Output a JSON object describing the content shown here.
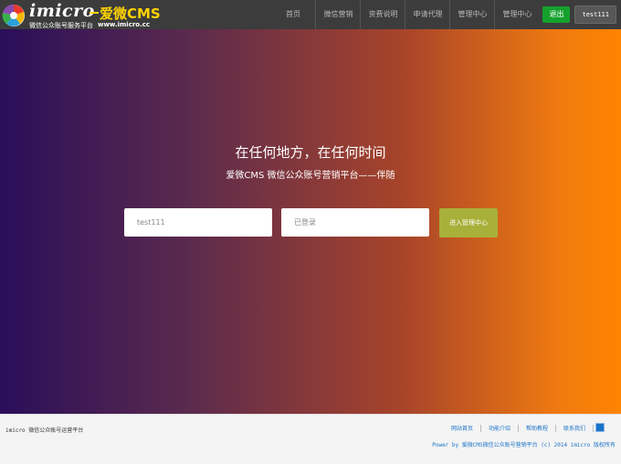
{
  "header": {
    "logo_word": "imicro",
    "logo_brand": "爱微CMS",
    "logo_sub": "微信公众账号服务平台",
    "logo_url": "www.imicro.cc",
    "nav": [
      "首页",
      "微信营销",
      "资费说明",
      "申请代理",
      "管理中心",
      "管理中心"
    ],
    "logout_label": "退出",
    "user_label": "test111"
  },
  "hero": {
    "title": "在任何地方，在任何时间",
    "subtitle": "爱微CMS 微信公众账号营销平台——伴随",
    "username_value": "test111",
    "password_value": "已登录",
    "enter_label": "进入管理中心"
  },
  "footer": {
    "left_text": "imicro 微信公众账号运营平台",
    "links": [
      "网站首页",
      "功能介绍",
      "帮助教程",
      "联系我们"
    ],
    "copyright": "Power by 爱微CMS微信公众账号营销平台 (c) 2014 imicro 版权所有"
  },
  "colors": {
    "header_bg": "#3c3c3c",
    "logout_green": "#15a12d",
    "enter_button": "#a8b03a",
    "link_blue": "#1b74c8"
  }
}
